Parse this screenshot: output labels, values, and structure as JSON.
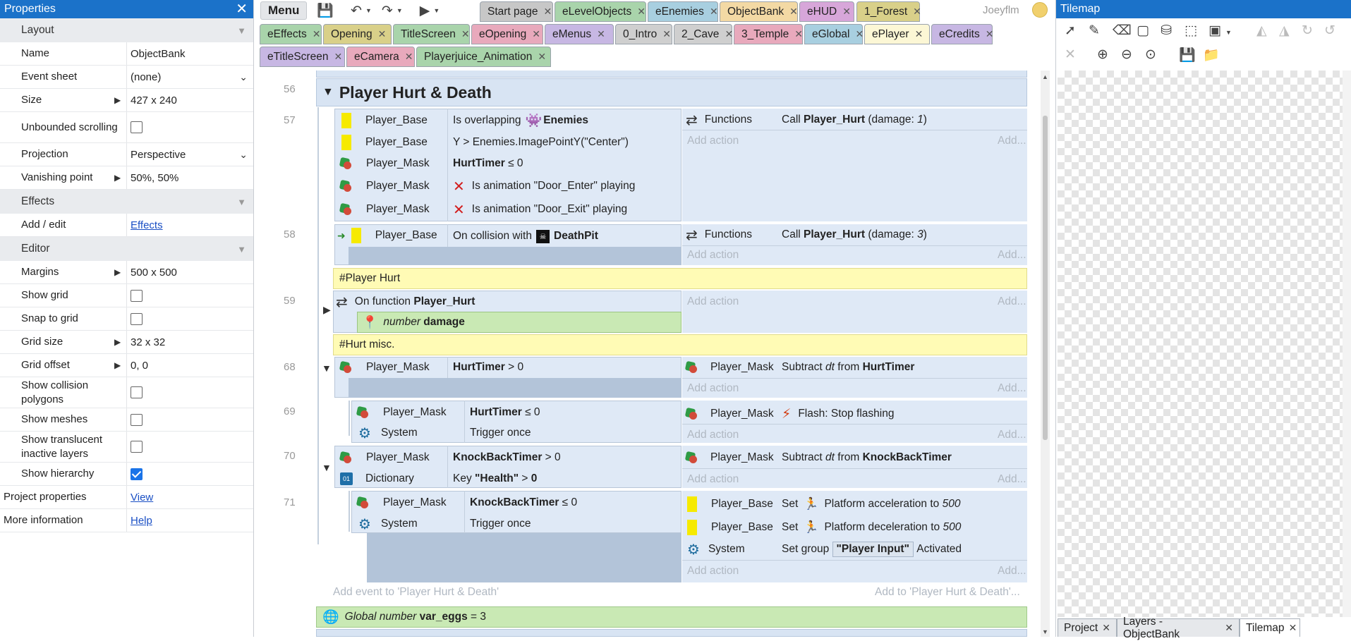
{
  "properties": {
    "title": "Properties",
    "groups": {
      "layout": "Layout",
      "effects": "Effects",
      "editor": "Editor"
    },
    "rows": {
      "name": {
        "label": "Name",
        "value": "ObjectBank"
      },
      "event_sheet": {
        "label": "Event sheet",
        "value": "(none)"
      },
      "size": {
        "label": "Size",
        "value": "427 x 240"
      },
      "unbounded": {
        "label": "Unbounded scrolling",
        "checked": false
      },
      "projection": {
        "label": "Projection",
        "value": "Perspective"
      },
      "vanishing": {
        "label": "Vanishing point",
        "value": "50%, 50%"
      },
      "add_edit": {
        "label": "Add / edit",
        "value": "Effects"
      },
      "margins": {
        "label": "Margins",
        "value": "500 x 500"
      },
      "show_grid": {
        "label": "Show grid",
        "checked": false
      },
      "snap_grid": {
        "label": "Snap to grid",
        "checked": false
      },
      "grid_size": {
        "label": "Grid size",
        "value": "32 x 32"
      },
      "grid_offset": {
        "label": "Grid offset",
        "value": "0, 0"
      },
      "show_collision": {
        "label": "Show collision polygons",
        "checked": false
      },
      "show_meshes": {
        "label": "Show meshes",
        "checked": false
      },
      "show_translucent": {
        "label": "Show translucent inactive layers",
        "checked": false
      },
      "show_hierarchy": {
        "label": "Show hierarchy",
        "checked": true
      },
      "project_props": {
        "label": "Project properties",
        "value": "View"
      },
      "more_info": {
        "label": "More information",
        "value": "Help"
      }
    }
  },
  "toolbar": {
    "menu": "Menu"
  },
  "user": {
    "name": "Joeyflm"
  },
  "tabs": [
    {
      "label": "Start page",
      "color": "#c7c7c7"
    },
    {
      "label": "eLevelObjects",
      "color": "#a9d4ab"
    },
    {
      "label": "eEnemies",
      "color": "#a8cfe0"
    },
    {
      "label": "ObjectBank",
      "color": "#f3d9a4"
    },
    {
      "label": "eHUD",
      "color": "#d7a6d9"
    },
    {
      "label": "1_Forest",
      "color": "#d9d089"
    },
    {
      "label": "eEffects",
      "color": "#a9d4ab"
    },
    {
      "label": "Opening",
      "color": "#d9d089"
    },
    {
      "label": "TitleScreen",
      "color": "#a9d4ab"
    },
    {
      "label": "eOpening",
      "color": "#e8a9bc"
    },
    {
      "label": "eMenus",
      "color": "#c7b7e3"
    },
    {
      "label": "0_Intro",
      "color": "#cfcfcf"
    },
    {
      "label": "2_Cave",
      "color": "#cfcfcf"
    },
    {
      "label": "3_Temple",
      "color": "#e8a9bc"
    },
    {
      "label": "eGlobal",
      "color": "#a8cfe0"
    },
    {
      "label": "ePlayer",
      "color": "#fcf7d5"
    },
    {
      "label": "eCredits",
      "color": "#c7b7e3"
    },
    {
      "label": "eTitleScreen",
      "color": "#c7b7e3"
    },
    {
      "label": "eCamera",
      "color": "#e8a9bc"
    },
    {
      "label": "Playerjuice_Animation",
      "color": "#a9d4ab"
    }
  ],
  "sheet": {
    "group_title": "Player Hurt & Death",
    "lines": {
      "l56": "56",
      "l57": "57",
      "l58": "58",
      "l59": "59",
      "l68": "68",
      "l69": "69",
      "l70": "70",
      "l71": "71"
    },
    "ev57": {
      "c1_obj": "Player_Base",
      "c1_pre": "Is overlapping",
      "c1_target": "Enemies",
      "c2_obj": "Player_Base",
      "c2_text": "Y > Enemies.ImagePointY(\"Center\")",
      "c3_obj": "Player_Mask",
      "c3_bold": "HurtTimer",
      "c3_rest": "≤ 0",
      "c4_obj": "Player_Mask",
      "c4_text": "Is animation \"Door_Enter\" playing",
      "c5_obj": "Player_Mask",
      "c5_text": "Is animation \"Door_Exit\" playing",
      "a1_obj": "Functions",
      "a1_pre": "Call",
      "a1_fn": "Player_Hurt",
      "a1_args_pre": "(damage:",
      "a1_arg": "1",
      "a1_args_post": ")"
    },
    "ev58": {
      "c1_obj": "Player_Base",
      "c1_pre": "On collision with",
      "c1_target": "DeathPit",
      "a1_obj": "Functions",
      "a1_pre": "Call",
      "a1_fn": "Player_Hurt",
      "a1_args_pre": "(damage:",
      "a1_arg": "3",
      "a1_args_post": ")"
    },
    "comment1": "#Player Hurt",
    "ev59": {
      "pre": "On function",
      "fn": "Player_Hurt",
      "param_type": "number",
      "param_name": "damage"
    },
    "comment2": "#Hurt misc.",
    "ev68": {
      "c1_obj": "Player_Mask",
      "c1_bold": "HurtTimer",
      "c1_rest": "> 0",
      "a1_obj": "Player_Mask",
      "a1_pre": "Subtract",
      "a1_dt": "dt",
      "a1_mid": "from",
      "a1_var": "HurtTimer"
    },
    "ev69": {
      "c1_obj": "Player_Mask",
      "c1_bold": "HurtTimer",
      "c1_rest": "≤ 0",
      "c2_obj": "System",
      "c2_text": "Trigger once",
      "a1_obj": "Player_Mask",
      "a1_text": "Flash: Stop flashing"
    },
    "ev70": {
      "c1_obj": "Player_Mask",
      "c1_bold": "KnockBackTimer",
      "c1_rest": "> 0",
      "c2_obj": "Dictionary",
      "c2_pre": "Key",
      "c2_key": "\"Health\"",
      "c2_op": ">",
      "c2_val": "0",
      "a1_obj": "Player_Mask",
      "a1_pre": "Subtract",
      "a1_dt": "dt",
      "a1_mid": "from",
      "a1_var": "KnockBackTimer"
    },
    "ev71": {
      "c1_obj": "Player_Mask",
      "c1_bold": "KnockBackTimer",
      "c1_rest": "≤ 0",
      "c2_obj": "System",
      "c2_text": "Trigger once",
      "a1_obj": "Player_Base",
      "a1_pre": "Set",
      "a1_text": "Platform acceleration to",
      "a1_val": "500",
      "a2_obj": "Player_Base",
      "a2_pre": "Set",
      "a2_text": "Platform deceleration to",
      "a2_val": "500",
      "a3_obj": "System",
      "a3_pre": "Set group",
      "a3_group": "\"Player Input\"",
      "a3_post": "Activated"
    },
    "add_action": "Add action",
    "add_more": "Add...",
    "add_event": "Add event to 'Player Hurt & Death'",
    "add_to": "Add to 'Player Hurt & Death'...",
    "global_var": {
      "pre": "Global number",
      "name": "var_eggs",
      "op": "=",
      "value": "3"
    }
  },
  "tilemap": {
    "title": "Tilemap"
  },
  "bottom_tabs": {
    "project": "Project",
    "layers": "Layers - ObjectBank",
    "tilemap": "Tilemap"
  },
  "colors": {
    "accent": "#1b72c9",
    "group": "#d8e4f3",
    "event": "#dfe9f6",
    "comment": "#fffbb5",
    "func": "#c9e9b4"
  }
}
